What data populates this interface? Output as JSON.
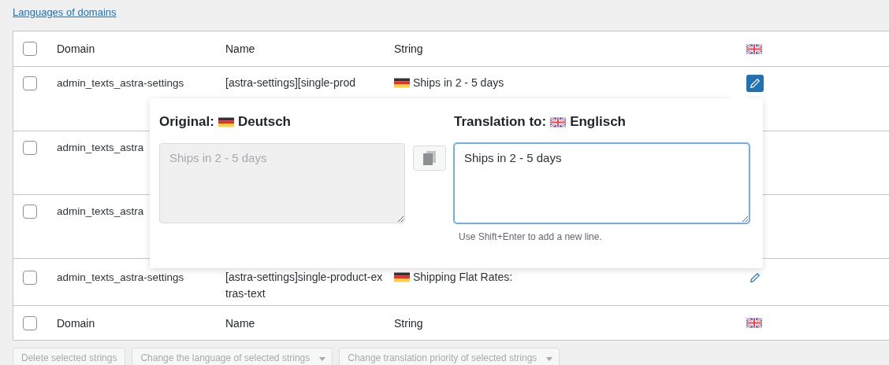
{
  "link": "Languages of domains",
  "table": {
    "header_checked": false,
    "columns": [
      "Domain",
      "Name",
      "String"
    ],
    "rows": [
      {
        "checked": false,
        "domain": "admin_texts_astra-settings",
        "name": "[astra-settings][single-prod",
        "string": "Ships in 2 - 5 days",
        "editing": true
      },
      {
        "checked": false,
        "domain": "admin_texts_astra"
      },
      {
        "checked": false,
        "domain": "admin_texts_astra"
      },
      {
        "checked": false,
        "domain": "admin_texts_astra-settings",
        "name": "[astra-settings]single-product-extras-text",
        "string": "Shipping Flat Rates:",
        "editing": false
      }
    ],
    "footer_checked": false,
    "footer_columns": [
      "Domain",
      "Name",
      "String"
    ]
  },
  "popup": {
    "original_label": "Original:",
    "original_language": "Deutsch",
    "original_text": "Ships in 2 - 5 days",
    "translation_label": "Translation to:",
    "translation_language": "Englisch",
    "translation_text": "Ships in 2 - 5 days",
    "hint": "Use Shift+Enter to add a new line."
  },
  "actions": [
    {
      "kind": "button",
      "label": "Delete selected strings"
    },
    {
      "kind": "select",
      "label": "Change the language of selected strings"
    },
    {
      "kind": "select",
      "label": "Change translation priority of selected strings"
    }
  ]
}
